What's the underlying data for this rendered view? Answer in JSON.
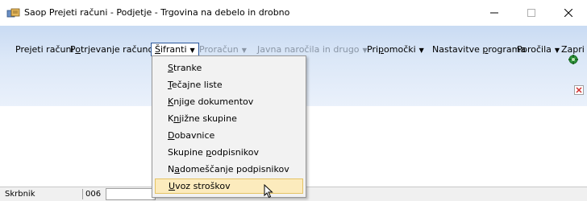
{
  "window": {
    "title": "Saop Prejeti računi - Podjetje - Trgovina na debelo in drobno",
    "minimize_glyph": "—",
    "maximize_glyph": "☐",
    "close_glyph": "✕"
  },
  "menu": {
    "items": [
      {
        "label": "Prejeti računi"
      },
      {
        "pre": "P",
        "u": "o",
        "post": "trjevanje računov"
      },
      {
        "pre": "",
        "u": "Š",
        "post": "ifranti"
      },
      {
        "label": "Proračun"
      },
      {
        "label": "Javna naročila in drugo"
      },
      {
        "pre": "Pri",
        "u": "p",
        "post": "omočki"
      },
      {
        "pre": "Nastavitve ",
        "u": "p",
        "post": "rograma"
      },
      {
        "label": "Poročila"
      },
      {
        "label": "Zapri"
      }
    ],
    "caret": "▼"
  },
  "dropdown": {
    "items": [
      {
        "pre": "",
        "u": "S",
        "post": "tranke"
      },
      {
        "pre": "",
        "u": "T",
        "post": "ečajne liste"
      },
      {
        "pre": "",
        "u": "K",
        "post": "njige dokumentov"
      },
      {
        "pre": "K",
        "u": "n",
        "post": "jižne skupine"
      },
      {
        "pre": "",
        "u": "D",
        "post": "obavnice"
      },
      {
        "pre": "Skupine ",
        "u": "p",
        "post": "odpisnikov"
      },
      {
        "pre": "N",
        "u": "a",
        "post": "domeščanje podpisnikov"
      },
      {
        "pre": "",
        "u": "U",
        "post": "voz stroškov"
      }
    ]
  },
  "statusbar": {
    "user_label": "Skrbnik",
    "code": "006"
  },
  "icons": {
    "app": "app-icon",
    "tools": "tools-icon",
    "close_doc": "close-document-icon"
  },
  "colors": {
    "ribbon_top": "#c9dbf3",
    "hover_bg": "#fcebbd",
    "hover_border": "#e5c365",
    "active_border": "#2b579a"
  }
}
